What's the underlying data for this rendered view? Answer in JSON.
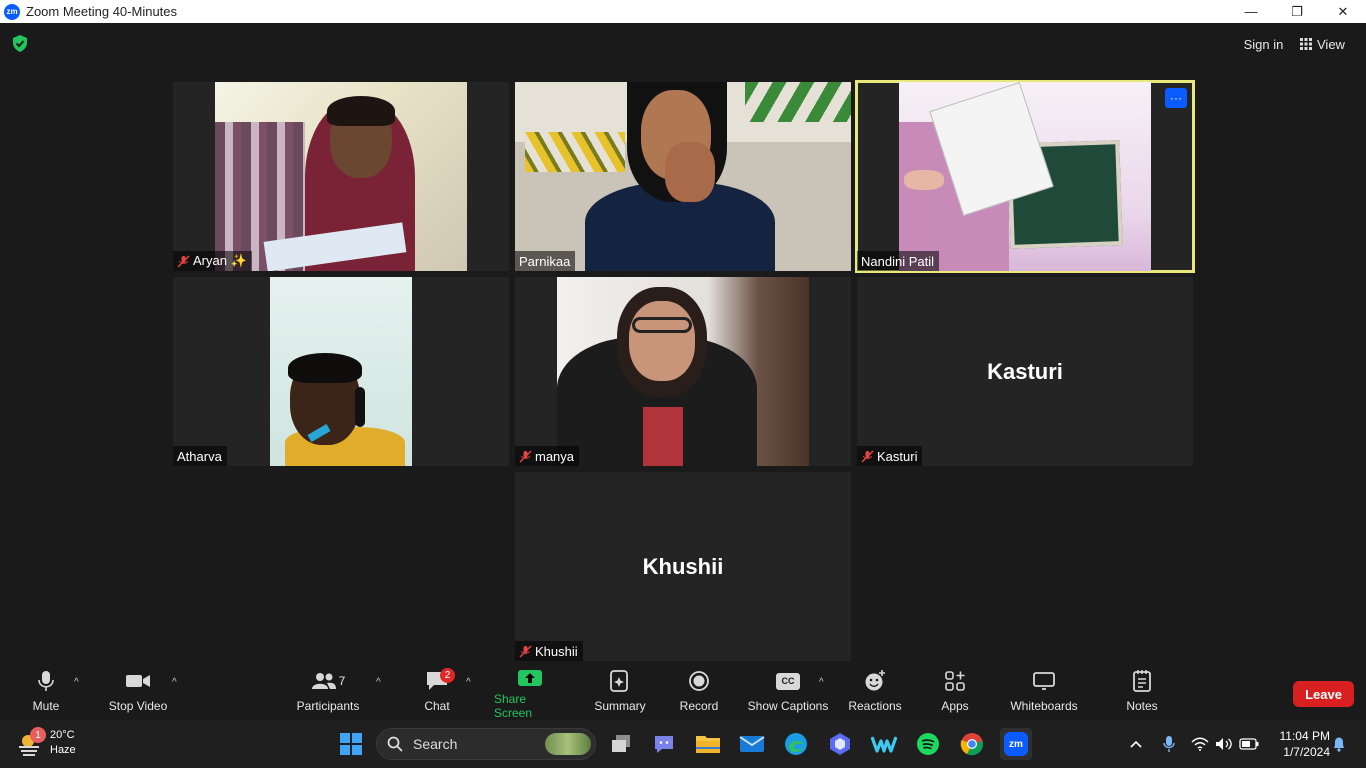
{
  "window": {
    "title": "Zoom Meeting 40-Minutes",
    "minimize": "—",
    "restore": "❐",
    "close": "✕"
  },
  "topbar": {
    "sign_in": "Sign in",
    "view": "View"
  },
  "participants_tiles": [
    {
      "name": "Aryan ✨",
      "muted": true,
      "video": true
    },
    {
      "name": "Parnikaa",
      "muted": false,
      "video": true
    },
    {
      "name": "Nandini Patil",
      "muted": false,
      "video": true,
      "active_speaker": true
    },
    {
      "name": "Atharva",
      "muted": false,
      "video": true
    },
    {
      "name": "manya",
      "muted": true,
      "video": true
    },
    {
      "name": "Kasturi",
      "muted": true,
      "video": false,
      "display_name": "Kasturi"
    },
    {
      "name": "Khushii",
      "muted": true,
      "video": false,
      "display_name": "Khushii"
    }
  ],
  "tile_more_label": "···",
  "toolbar": {
    "mute": "Mute",
    "stop_video": "Stop Video",
    "participants": "Participants",
    "participants_count": "7",
    "chat": "Chat",
    "chat_badge": "2",
    "share_screen": "Share Screen",
    "summary": "Summary",
    "record": "Record",
    "show_captions": "Show Captions",
    "captions_icon_text": "CC",
    "reactions": "Reactions",
    "apps": "Apps",
    "whiteboards": "Whiteboards",
    "notes": "Notes",
    "leave": "Leave",
    "caret": "^"
  },
  "taskbar": {
    "weather_temp": "20°C",
    "weather_desc": "Haze",
    "weather_badge": "1",
    "search_label": "Search",
    "time": "11:04 PM",
    "date": "1/7/2024",
    "zoom_icon_text": "zm"
  },
  "colors": {
    "accent_blue": "#0b5cff",
    "share_green": "#22c55e",
    "leave_red": "#d92020",
    "active_border": "#e7ea7a"
  }
}
